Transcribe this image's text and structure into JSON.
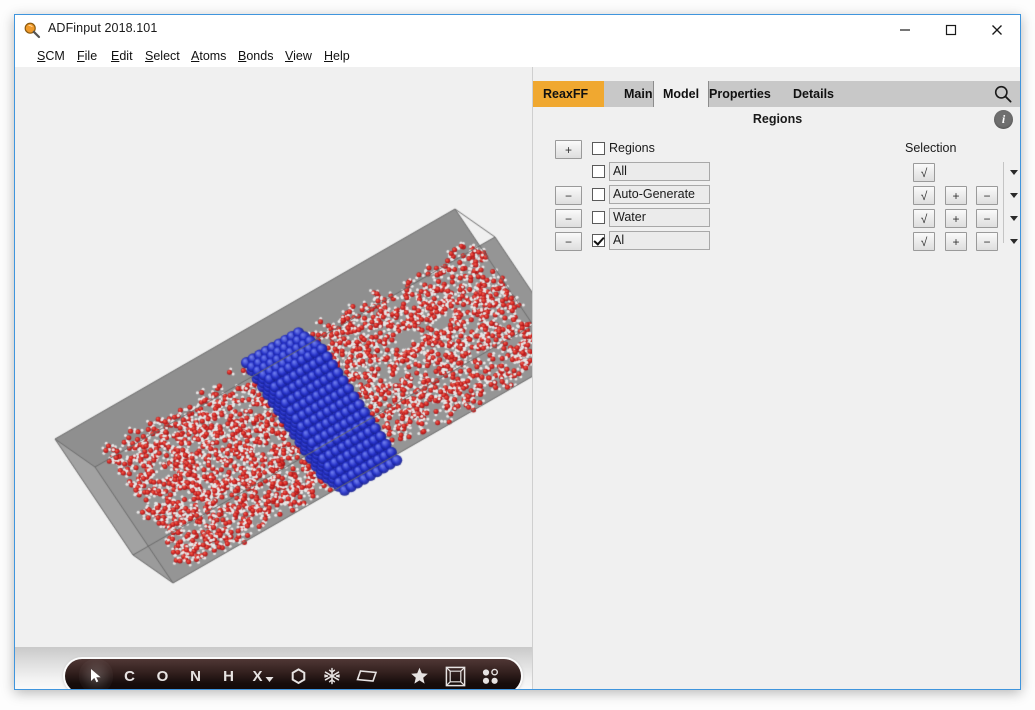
{
  "window": {
    "title": "ADFinput 2018.101",
    "app_icon": "magnifier-icon",
    "controls": {
      "minimize": "minimize-icon",
      "maximize": "maximize-icon",
      "close": "close-icon"
    }
  },
  "menubar": {
    "items": [
      {
        "label": "SCM",
        "mnemonic": "S"
      },
      {
        "label": "File",
        "mnemonic": "F"
      },
      {
        "label": "Edit",
        "mnemonic": "E"
      },
      {
        "label": "Select",
        "mnemonic": "S"
      },
      {
        "label": "Atoms",
        "mnemonic": "A"
      },
      {
        "label": "Bonds",
        "mnemonic": "B"
      },
      {
        "label": "View",
        "mnemonic": "V"
      },
      {
        "label": "Help",
        "mnemonic": "H"
      }
    ]
  },
  "tabs": {
    "items": [
      {
        "label": "ReaxFF",
        "state": "module",
        "color": "#f0a830"
      },
      {
        "label": "Main",
        "state": "normal",
        "color": "#c8c8c8"
      },
      {
        "label": "Model",
        "state": "active",
        "color": "#f0f0f0"
      },
      {
        "label": "Properties",
        "state": "normal",
        "color": "#c8c8c8"
      },
      {
        "label": "Details",
        "state": "normal",
        "color": "#c8c8c8"
      }
    ],
    "search_icon": "search-icon"
  },
  "panel": {
    "title": "Regions",
    "info_icon": "info-icon",
    "info_label": "i"
  },
  "regions_grid": {
    "headers": {
      "add_button": "+",
      "regions": "Regions",
      "selection": "Selection"
    },
    "buttons": {
      "remove": "−",
      "check": "√",
      "plus": "+",
      "minus": "−"
    },
    "header_checkbox": false,
    "rows": [
      {
        "name": "All",
        "checked": false,
        "has_remove": false,
        "selection": {
          "check": true,
          "plus": false,
          "minus": false,
          "dropdown": true
        }
      },
      {
        "name": "Auto-Generate",
        "checked": false,
        "has_remove": true,
        "selection": {
          "check": true,
          "plus": true,
          "minus": true,
          "dropdown": true
        }
      },
      {
        "name": "Water",
        "checked": false,
        "has_remove": true,
        "selection": {
          "check": true,
          "plus": true,
          "minus": true,
          "dropdown": true
        }
      },
      {
        "name": "Al",
        "checked": true,
        "has_remove": true,
        "selection": {
          "check": true,
          "plus": true,
          "minus": true,
          "dropdown": true
        }
      }
    ]
  },
  "viewer": {
    "background": "#f0f0f0",
    "scene": {
      "description": "periodic simulation cell with water slab and aluminium surface",
      "box_color": "#959595",
      "box_edge_color": "#6a6a6a",
      "water_oxygen_color": "#cc2020",
      "water_hydrogen_color": "#e8e8e8",
      "aluminium_color": "#2430c8"
    },
    "toolbar": {
      "items": [
        {
          "icon": "cursor-arrow-icon",
          "label": "",
          "selected": true
        },
        {
          "icon": "atom-c-icon",
          "label": "C",
          "selected": false
        },
        {
          "icon": "atom-o-icon",
          "label": "O",
          "selected": false
        },
        {
          "icon": "atom-n-icon",
          "label": "N",
          "selected": false
        },
        {
          "icon": "atom-h-icon",
          "label": "H",
          "selected": false
        },
        {
          "icon": "atom-x-dropdown-icon",
          "label": "X",
          "selected": false
        },
        {
          "icon": "ring-icon",
          "label": "",
          "selected": false
        },
        {
          "icon": "snowflake-icon",
          "label": "",
          "selected": false
        },
        {
          "icon": "plane-icon",
          "label": "",
          "selected": false
        },
        {
          "icon": "star-icon",
          "label": "",
          "selected": false
        },
        {
          "icon": "crystal-box-icon",
          "label": "",
          "selected": false
        },
        {
          "icon": "four-dots-icon",
          "label": "",
          "selected": false
        }
      ]
    }
  }
}
